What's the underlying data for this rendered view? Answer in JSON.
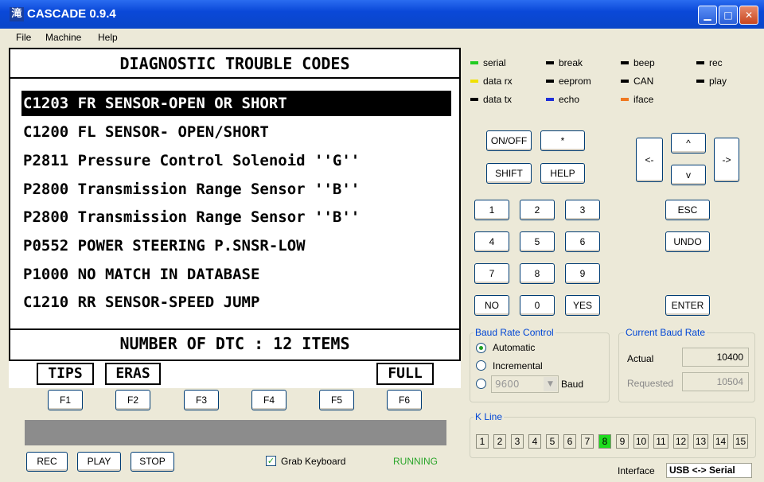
{
  "window": {
    "title": "CASCADE 0.9.4",
    "icon_glyph": "滝"
  },
  "menu": [
    "File",
    "Machine",
    "Help"
  ],
  "lcd": {
    "title": "DIAGNOSTIC TROUBLE CODES",
    "codes": [
      "C1203 FR SENSOR-OPEN OR SHORT",
      "C1200 FL SENSOR- OPEN/SHORT",
      "P2811 Pressure Control Solenoid ''G''",
      "P2800 Transmission Range Sensor ''B''",
      "P2800 Transmission Range Sensor ''B''",
      "P0552 POWER STEERING P.SNSR-LOW",
      "P1000 NO MATCH IN DATABASE",
      "C1210 RR SENSOR-SPEED JUMP"
    ],
    "selected_index": 0,
    "footer": "NUMBER OF DTC  : 12 ITEMS"
  },
  "softkey_labels": {
    "tips": "TIPS",
    "eras": "ERAS",
    "full": "FULL"
  },
  "fkeys": [
    "F1",
    "F2",
    "F3",
    "F4",
    "F5",
    "F6"
  ],
  "bottom": {
    "rec": "REC",
    "play": "PLAY",
    "stop": "STOP",
    "grab_keyboard": "Grab Keyboard",
    "grab_checked": true,
    "status": "RUNNING",
    "status_color": "#2aa52a"
  },
  "legend": [
    {
      "label": "serial",
      "color": "#22cc22"
    },
    {
      "label": "break",
      "color": "#000000"
    },
    {
      "label": "beep",
      "color": "#000000"
    },
    {
      "label": "rec",
      "color": "#000000"
    },
    {
      "label": "data rx",
      "color": "#f0e000"
    },
    {
      "label": "eeprom",
      "color": "#000000"
    },
    {
      "label": "CAN",
      "color": "#000000"
    },
    {
      "label": "play",
      "color": "#000000"
    },
    {
      "label": "data tx",
      "color": "#000000"
    },
    {
      "label": "echo",
      "color": "#1f2fd8"
    },
    {
      "label": "iface",
      "color": "#f07820"
    }
  ],
  "keypad": {
    "on_off": "ON/OFF",
    "star": "*",
    "shift": "SHIFT",
    "help": "HELP",
    "digits": [
      "1",
      "2",
      "3",
      "4",
      "5",
      "6",
      "7",
      "8",
      "9",
      "NO",
      "0",
      "YES"
    ],
    "left": "<-",
    "right": "->",
    "up": "^",
    "down": "v",
    "esc": "ESC",
    "undo": "UNDO",
    "enter": "ENTER"
  },
  "baud_control": {
    "title": "Baud Rate Control",
    "options": [
      "Automatic",
      "Incremental"
    ],
    "selected": "Automatic",
    "custom_value": "9600",
    "unit": "Baud"
  },
  "current_baud": {
    "title": "Current Baud Rate",
    "actual_label": "Actual",
    "actual_value": "10400",
    "requested_label": "Requested",
    "requested_value": "10504"
  },
  "kline": {
    "title": "K Line",
    "lines": [
      "1",
      "2",
      "3",
      "4",
      "5",
      "6",
      "7",
      "8",
      "9",
      "10",
      "11",
      "12",
      "13",
      "14",
      "15"
    ],
    "active": "8"
  },
  "interface": {
    "label": "Interface",
    "value": "USB <-> Serial"
  }
}
